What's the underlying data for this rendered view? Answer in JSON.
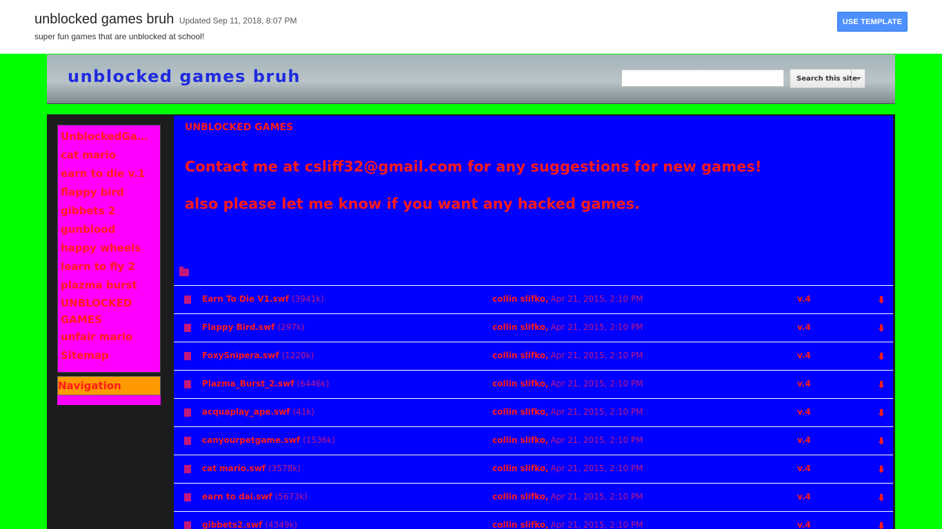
{
  "template_bar": {
    "title": "unblocked games bruh",
    "updated": "Updated Sep 11, 2018, 8:07 PM",
    "subtitle": "super fun games that are unblocked at school!",
    "use_template_label": "USE TEMPLATE"
  },
  "header": {
    "site_title": "unblocked games bruh",
    "search_placeholder": "",
    "search_button_label": "Search this site"
  },
  "sidebar": {
    "items": [
      {
        "label": "UnblockedGames"
      },
      {
        "label": "cat mario"
      },
      {
        "label": "earn to die v.1"
      },
      {
        "label": "flappy bird"
      },
      {
        "label": "gibbets 2"
      },
      {
        "label": "gunblood"
      },
      {
        "label": "happy wheels"
      },
      {
        "label": "learn to fly 2"
      },
      {
        "label": "plazma burst"
      },
      {
        "label": "UNBLOCKED GAMES"
      },
      {
        "label": "unfair mario"
      },
      {
        "label": "Sitemap"
      }
    ],
    "navigation_label": "Navigation"
  },
  "content": {
    "heading": "UNBLOCKED GAMES",
    "para1": "Contact me at csliff32@gmail.com for any suggestions for new games!",
    "para2": "also please let me know if you want any hacked games."
  },
  "files": [
    {
      "name": "Earn To Die V1.swf",
      "size": "(3941k)",
      "author": "collin slifko,",
      "date": "Apr 21, 2015, 2:10 PM",
      "version": "v.4"
    },
    {
      "name": "Flappy Bird.swf",
      "size": "(297k)",
      "author": "collin slifko,",
      "date": "Apr 21, 2015, 2:10 PM",
      "version": "v.4"
    },
    {
      "name": "FoxySnipera.swf",
      "size": "(1220k)",
      "author": "collin slifko,",
      "date": "Apr 21, 2015, 2:10 PM",
      "version": "v.4"
    },
    {
      "name": "Plazma_Burst_2.swf",
      "size": "(6446k)",
      "author": "collin slifko,",
      "date": "Apr 21, 2015, 2:10 PM",
      "version": "v.4"
    },
    {
      "name": "acquaplay_ape.swf",
      "size": "(41k)",
      "author": "collin slifko,",
      "date": "Apr 21, 2015, 2:10 PM",
      "version": "v.4"
    },
    {
      "name": "canyourpetgame.swf",
      "size": "(1536k)",
      "author": "collin slifko,",
      "date": "Apr 21, 2015, 2:10 PM",
      "version": "v.4"
    },
    {
      "name": "cat mario.swf",
      "size": "(3578k)",
      "author": "collin slifko,",
      "date": "Apr 21, 2015, 2:10 PM",
      "version": "v.4"
    },
    {
      "name": "earn to dai.swf",
      "size": "(5673k)",
      "author": "collin slifko,",
      "date": "Apr 21, 2015, 2:10 PM",
      "version": "v.4"
    },
    {
      "name": "gibbets2.swf",
      "size": "(4349k)",
      "author": "collin slifko,",
      "date": "Apr 21, 2015, 2:10 PM",
      "version": "v.4"
    }
  ]
}
